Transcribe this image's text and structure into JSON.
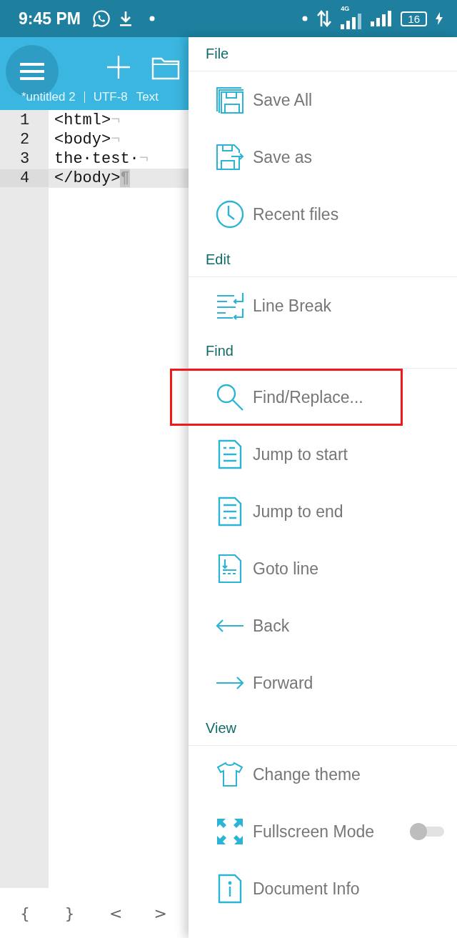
{
  "status_bar": {
    "time": "9:45 PM",
    "network": "4G",
    "battery": "16"
  },
  "toolbar": {
    "tab_title": "*untitled 2",
    "encoding": "UTF-8",
    "mode": "Text"
  },
  "editor": {
    "lines": [
      {
        "number": "1",
        "code": "<html>",
        "eol": "¬",
        "current": false
      },
      {
        "number": "2",
        "code": "<body>",
        "eol": "¬",
        "current": false
      },
      {
        "number": "3",
        "code": "the·test·",
        "eol": "¬",
        "current": false
      },
      {
        "number": "4",
        "code": "</body>",
        "eol": "¶",
        "current": true
      }
    ]
  },
  "symbol_bar": [
    "{",
    "}",
    "<",
    ">"
  ],
  "drawer": {
    "sections": [
      {
        "title": "File",
        "items": [
          {
            "label": "Save All",
            "kind": "action",
            "highlighted": false
          },
          {
            "label": "Save as",
            "kind": "action",
            "highlighted": false
          },
          {
            "label": "Recent files",
            "kind": "action",
            "highlighted": false
          }
        ]
      },
      {
        "title": "Edit",
        "items": [
          {
            "label": "Line Break",
            "kind": "action",
            "highlighted": false
          }
        ]
      },
      {
        "title": "Find",
        "items": [
          {
            "label": "Find/Replace...",
            "kind": "action",
            "highlighted": true
          },
          {
            "label": "Jump to start",
            "kind": "action",
            "highlighted": false
          },
          {
            "label": "Jump to end",
            "kind": "action",
            "highlighted": false
          },
          {
            "label": "Goto line",
            "kind": "action",
            "highlighted": false
          },
          {
            "label": "Back",
            "kind": "action",
            "highlighted": false
          },
          {
            "label": "Forward",
            "kind": "action",
            "highlighted": false
          }
        ]
      },
      {
        "title": "View",
        "items": [
          {
            "label": "Change theme",
            "kind": "action",
            "highlighted": false
          },
          {
            "label": "Fullscreen Mode",
            "kind": "toggle",
            "on": false,
            "highlighted": false
          },
          {
            "label": "Document Info",
            "kind": "action",
            "highlighted": false
          }
        ]
      }
    ]
  }
}
